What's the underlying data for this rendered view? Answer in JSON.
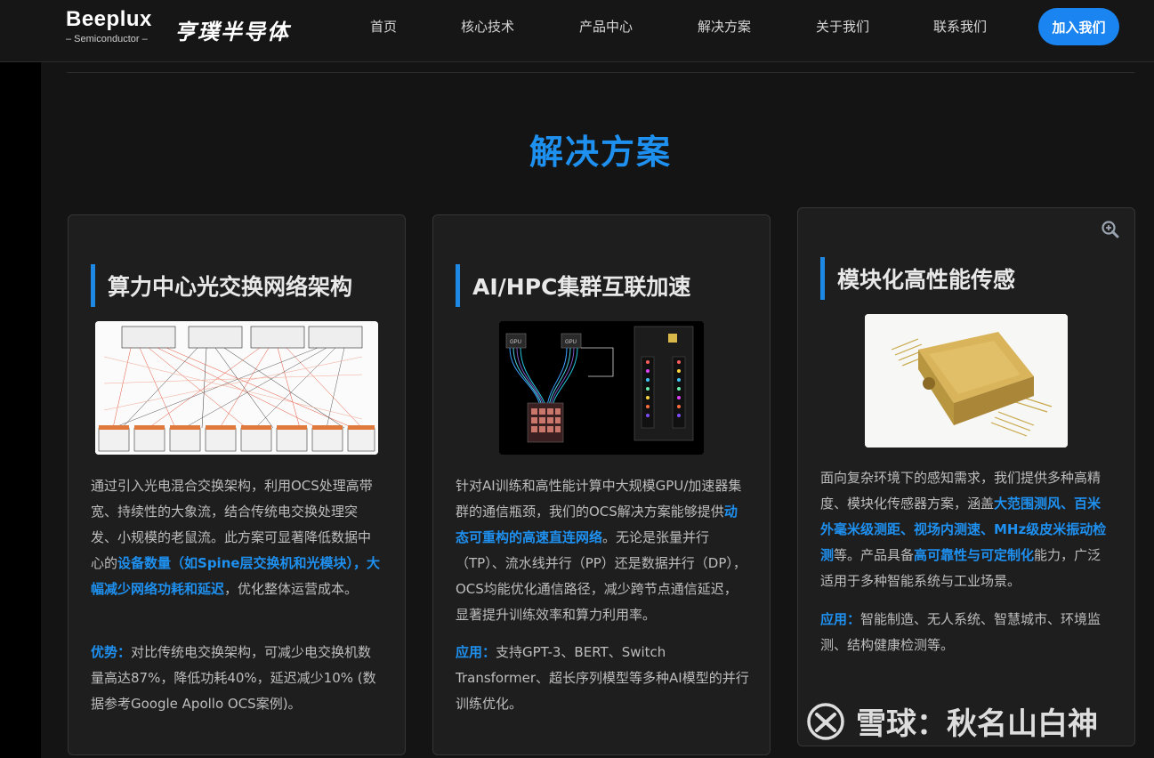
{
  "header": {
    "logo_main": "Beeplux",
    "logo_sub": "– Semiconductor –",
    "logo_cn": "亨璞半导体",
    "nav": [
      {
        "label": "首页"
      },
      {
        "label": "核心技术"
      },
      {
        "label": "产品中心"
      },
      {
        "label": "解决方案"
      },
      {
        "label": "关于我们"
      },
      {
        "label": "联系我们"
      }
    ],
    "join_label": "加入我们"
  },
  "section": {
    "title": "解决方案"
  },
  "cards": [
    {
      "title": "算力中心光交换网络架构",
      "image_name": "ocs-network-diagram",
      "body": [
        {
          "t": "通过引入光电混合交换架构，利用OCS处理高带宽、持续性的大象流，结合传统电交换处理突发、小规模的老鼠流。此方案可显著降低数据中心的"
        },
        {
          "t": "设备数量（如Spine层交换机和光模块），大幅减少网络功耗和延迟",
          "hl": true
        },
        {
          "t": "，优化整体运营成本。"
        }
      ],
      "extra_label": "优势：",
      "extra": "对比传统电交换架构，可减少电交换机数量高达87%，降低功耗40%，延迟减少10% (数据参考Google Apollo OCS案例)。"
    },
    {
      "title": "AI/HPC集群互联加速",
      "image_name": "gpu-cluster-interconnect",
      "body": [
        {
          "t": "针对AI训练和高性能计算中大规模GPU/加速器集群的通信瓶颈，我们的OCS解决方案能够提供"
        },
        {
          "t": "动态可重构的高速直连网络",
          "hl": true
        },
        {
          "t": "。无论是张量并行（TP）、流水线并行（PP）还是数据并行（DP），OCS均能优化通信路径，减少跨节点通信延迟，显著提升训练效率和算力利用率。"
        }
      ],
      "extra_label": "应用：",
      "extra": "支持GPT-3、BERT、Switch Transformer、超长序列模型等多种AI模型的并行训练优化。"
    },
    {
      "title": "模块化高性能传感",
      "image_name": "sensor-module-photo",
      "body": [
        {
          "t": "面向复杂环境下的感知需求，我们提供多种高精度、模块化传感器方案，涵盖"
        },
        {
          "t": "大范围测风、百米外毫米级测距、视场内测速、MHz级皮米振动检测",
          "hl": true
        },
        {
          "t": "等。产品具备"
        },
        {
          "t": "高可靠性与可定制化",
          "hl": true
        },
        {
          "t": "能力，广泛适用于多种智能系统与工业场景。"
        }
      ],
      "extra_label": "应用：",
      "extra": "智能制造、无人系统、智慧城市、环境监测、结构健康检测等。"
    }
  ],
  "gpu_label": "GPU",
  "watermark": "雪球：秋名山白神",
  "colors": {
    "accent": "#1e90f0",
    "button": "#1a84f0",
    "bg": "#141414",
    "card": "#1e1e1e"
  }
}
